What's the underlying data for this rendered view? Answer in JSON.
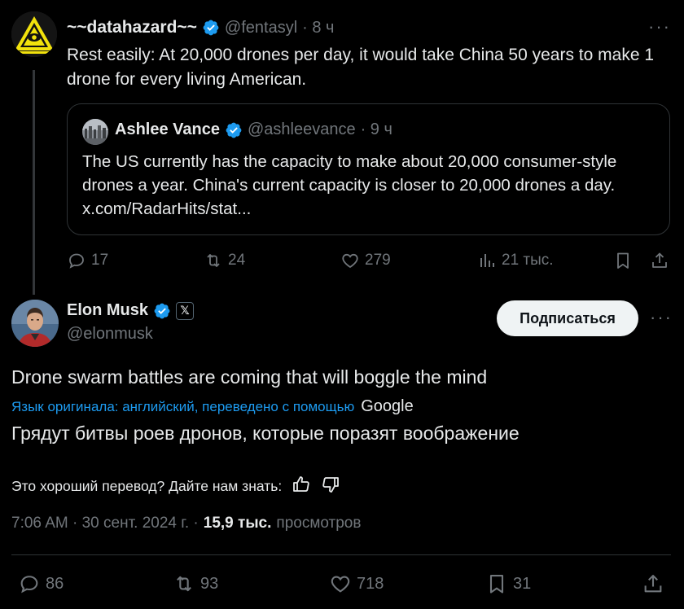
{
  "parent": {
    "display_name": "~~datahazard~~",
    "handle": "@fentasyl",
    "time": "· 8 ч",
    "more": "···",
    "text": "Rest easily: At 20,000 drones per day, it would take China 50 years to make 1 drone for every living American.",
    "quote": {
      "display_name": "Ashlee Vance",
      "handle": "@ashleevance",
      "time": "· 9 ч",
      "text": "The US currently has the capacity to make about 20,000 consumer-style drones a year. China's current capacity is closer to 20,000 drones a day. x.com/RadarHits/stat..."
    },
    "actions": {
      "replies": "17",
      "reposts": "24",
      "likes": "279",
      "views": "21 тыс."
    }
  },
  "main": {
    "display_name": "Elon Musk",
    "handle": "@elonmusk",
    "affiliate_badge": "𝕏",
    "follow_label": "Подписаться",
    "more": "···",
    "text": "Drone swarm battles are coming that will boggle the mind",
    "translate_note": "Язык оригинала: английский, переведено с помощью",
    "translate_provider": "Google",
    "translated_text": "Грядут битвы роев дронов, которые поразят воображение",
    "feedback_question": "Это хороший перевод? Дайте нам знать:",
    "timestamp": "7:06 AM · 30 сент. 2024 г. ·",
    "views_count": "15,9 тыс.",
    "views_label": "просмотров",
    "actions": {
      "replies": "86",
      "reposts": "93",
      "likes": "718",
      "bookmarks": "31"
    }
  },
  "colors": {
    "background": "#000000",
    "text": "#e7e9ea",
    "muted": "#71767b",
    "accent": "#1d9bf0",
    "border": "#2f3336"
  },
  "icons": [
    "hazard-logo-avatar",
    "verified-badge-icon",
    "reply-icon",
    "repost-icon",
    "like-icon",
    "views-icon",
    "bookmark-icon",
    "share-icon",
    "thumbs-up-icon",
    "thumbs-down-icon"
  ]
}
